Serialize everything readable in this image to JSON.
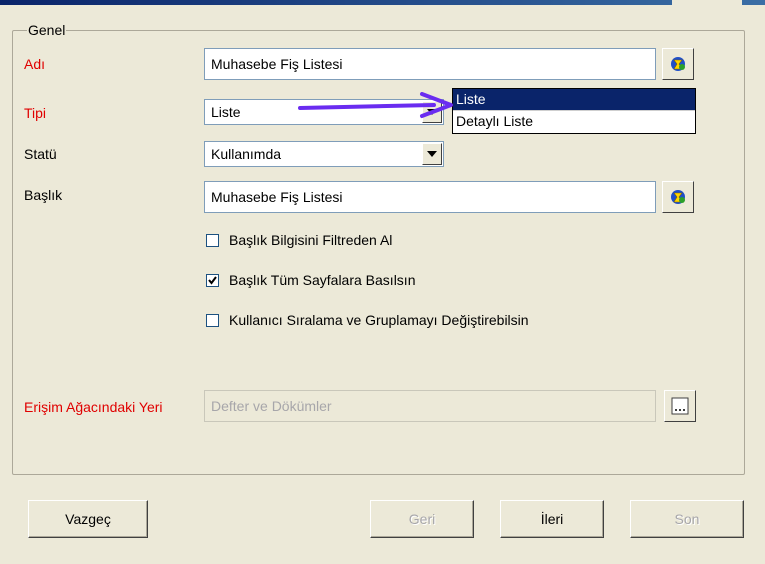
{
  "group_title": "Genel",
  "fields": {
    "adi": {
      "label": "Adı",
      "value": "Muhasebe Fiş Listesi"
    },
    "tipi": {
      "label": "Tipi",
      "value": "Liste",
      "options": [
        "Liste",
        "Detaylı Liste"
      ],
      "selected_option": "Liste"
    },
    "statu": {
      "label": "Statü",
      "value": "Kullanımda"
    },
    "baslik": {
      "label": "Başlık",
      "value": "Muhasebe Fiş Listesi"
    },
    "erisim": {
      "label": "Erişim Ağacındaki Yeri",
      "value": "Defter ve Dökümler"
    }
  },
  "checkboxes": [
    {
      "label": "Başlık Bilgisini Filtreden Al",
      "checked": false
    },
    {
      "label": "Başlık Tüm Sayfalara Basılsın",
      "checked": true
    },
    {
      "label": "Kullanıcı Sıralama ve Gruplamayı Değiştirebilsin",
      "checked": false
    }
  ],
  "buttons": {
    "vazgec": "Vazgeç",
    "geri": "Geri",
    "ileri": "İleri",
    "son": "Son"
  },
  "colors": {
    "required_label": "#e00000",
    "selection": "#0a246a",
    "annotation_arrow": "#6a2cf0"
  },
  "icons": [
    "translate-icon",
    "dropdown-arrow-icon",
    "ellipsis-icon",
    "checkmark-icon"
  ]
}
